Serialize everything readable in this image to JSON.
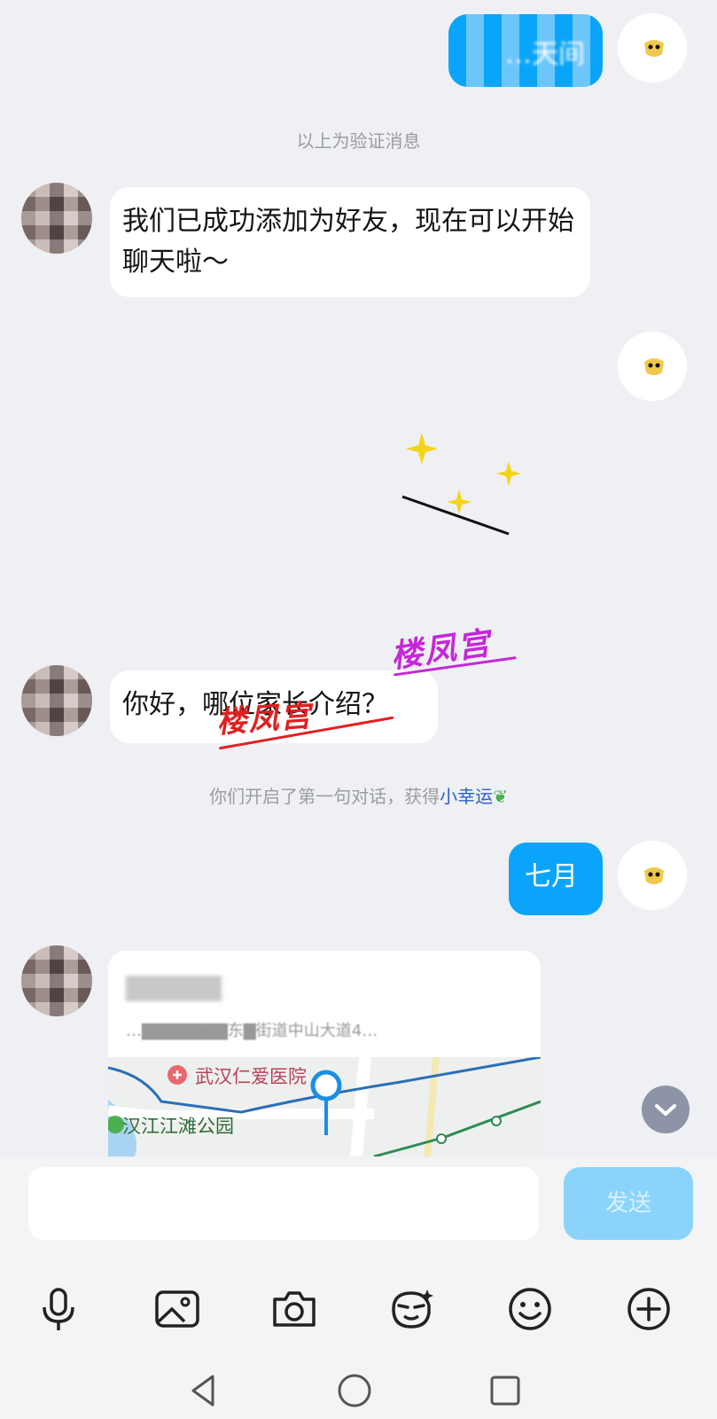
{
  "messages": {
    "top_mine_blurred": "…天间",
    "system_verify": "以上为验证消息",
    "friend_added": "我们已成功添加为好友，现在可以开始聊天啦～",
    "hello": "你好，哪位家长介绍？",
    "system_first_chat_prefix": "你们开启了第一句对话，获得",
    "system_first_chat_link": "小幸运",
    "reply_month": "七月",
    "location_title_blurred": "▇▇▇▇▇",
    "location_address": "…▇▇▇▇▇▇▇东▇街道中山大道4…",
    "map_poi_hospital": "武汉仁爱医院",
    "map_poi_park": "汉江江滩公园"
  },
  "watermark": {
    "text": "楼凤宫"
  },
  "input": {
    "placeholder": "",
    "send_label": "发送"
  },
  "toolbar": {
    "items": [
      "mic-icon",
      "image-icon",
      "camera-icon",
      "sticker-icon",
      "emoji-icon",
      "plus-icon"
    ]
  },
  "colors": {
    "accent": "#0aa5fa",
    "send_disabled": "#8ad4fb",
    "link": "#2d5fc9",
    "background": "#eff0f4"
  }
}
